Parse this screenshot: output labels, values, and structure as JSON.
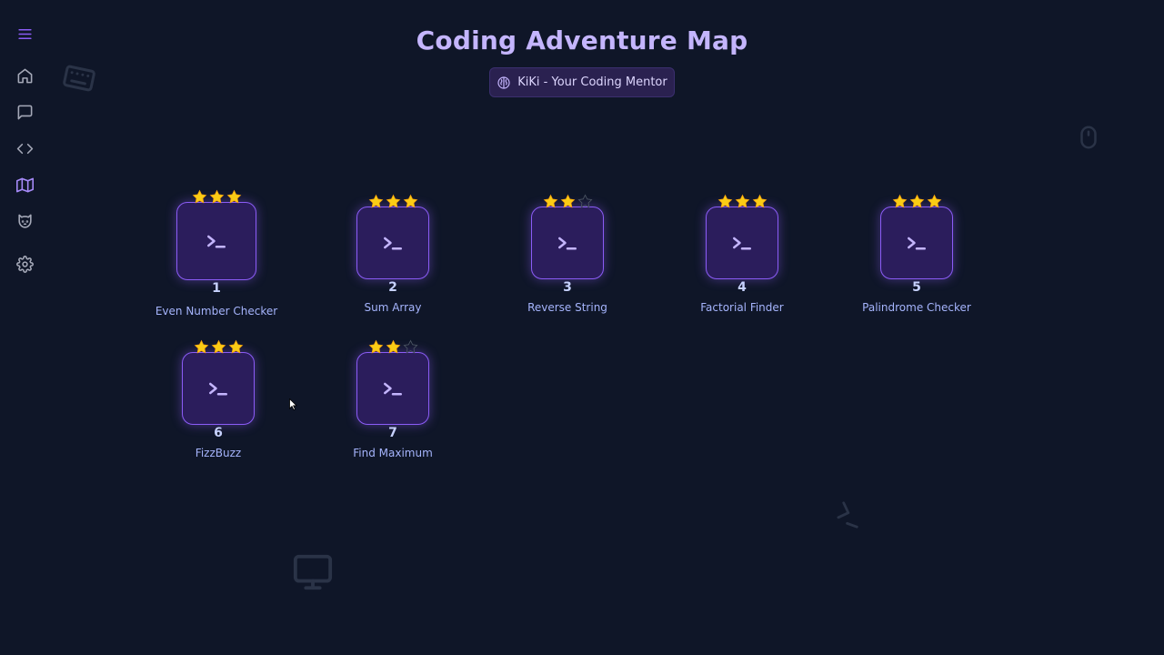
{
  "header": {
    "title": "Coding Adventure Map",
    "mentor_label": "KiKi - Your Coding Mentor"
  },
  "sidebar": {
    "items": [
      {
        "name": "menu",
        "icon": "menu-icon"
      },
      {
        "name": "home",
        "icon": "home-icon"
      },
      {
        "name": "chat",
        "icon": "chat-icon"
      },
      {
        "name": "code",
        "icon": "code-icon"
      },
      {
        "name": "map",
        "icon": "map-icon",
        "active": true
      },
      {
        "name": "cat",
        "icon": "cat-icon"
      },
      {
        "name": "settings",
        "icon": "gear-icon"
      }
    ]
  },
  "levels": [
    {
      "number": "1",
      "name": "Even Number Checker",
      "stars": 3,
      "icon": "terminal-icon"
    },
    {
      "number": "2",
      "name": "Sum Array",
      "stars": 3,
      "icon": "terminal-icon"
    },
    {
      "number": "3",
      "name": "Reverse String",
      "stars": 2,
      "icon": "terminal-icon"
    },
    {
      "number": "4",
      "name": "Factorial Finder",
      "stars": 3,
      "icon": "terminal-icon"
    },
    {
      "number": "5",
      "name": "Palindrome Checker",
      "stars": 3,
      "icon": "terminal-icon"
    },
    {
      "number": "6",
      "name": "FizzBuzz",
      "stars": 3,
      "icon": "terminal-icon"
    },
    {
      "number": "7",
      "name": "Find Maximum",
      "stars": 2,
      "icon": "terminal-icon"
    }
  ],
  "colors": {
    "background": "#0f1628",
    "accent": "#8b5cf6",
    "title": "#c4b5fd",
    "star": "#facc15"
  }
}
